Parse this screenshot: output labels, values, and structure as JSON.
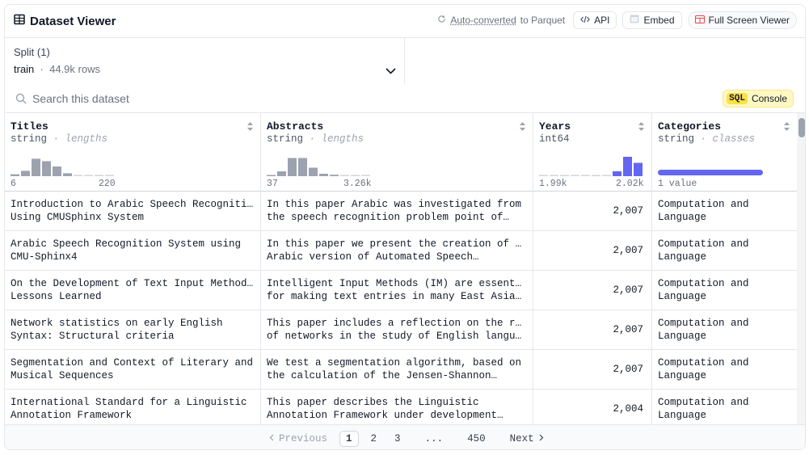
{
  "header": {
    "title": "Dataset Viewer",
    "auto_converted": "Auto-converted",
    "to_parquet": "to Parquet",
    "api": "API",
    "embed": "Embed",
    "full_screen": "Full Screen Viewer"
  },
  "split": {
    "label": "Split (1)",
    "value": "train",
    "rows": "44.9k rows"
  },
  "search": {
    "placeholder": "Search this dataset"
  },
  "sql": {
    "tag": "SQL",
    "label": "Console"
  },
  "colors": {
    "hist_gray": "#9ca3af",
    "hist_accent": "#6366f1",
    "border": "#e5e7eb"
  },
  "columns": [
    {
      "name": "Titles",
      "type": "string",
      "sub": "lengths",
      "min": "6",
      "max": "220",
      "hist": [
        0.08,
        0.22,
        0.72,
        0.62,
        0.4,
        0.12,
        0.04,
        0.03,
        0.03,
        0.02
      ]
    },
    {
      "name": "Abstracts",
      "type": "string",
      "sub": "lengths",
      "min": "37",
      "max": "3.26k",
      "hist": [
        0.05,
        0.2,
        0.75,
        0.75,
        0.35,
        0.1,
        0.06,
        0.03,
        0.02,
        0.02
      ]
    },
    {
      "name": "Years",
      "type": "int64",
      "sub": "",
      "min": "1.99k",
      "max": "2.02k",
      "hist": [
        0.02,
        0.02,
        0.02,
        0.02,
        0.02,
        0.03,
        0.03,
        0.2,
        0.8,
        0.55
      ]
    },
    {
      "name": "Categories",
      "type": "string",
      "sub": "classes",
      "min": "1 value",
      "max": "",
      "hist": [
        1.0
      ]
    }
  ],
  "rows": [
    {
      "title": [
        "Introduction to Arabic Speech Recognition",
        "Using CMUSphinx System"
      ],
      "abstract": [
        "In this paper Arabic was investigated from",
        "the speech recognition problem point of…"
      ],
      "year": "2,007",
      "category": [
        "Computation and",
        "Language"
      ]
    },
    {
      "title": [
        "Arabic Speech Recognition System using",
        "CMU-Sphinx4"
      ],
      "abstract": [
        "In this paper we present the creation of an",
        "Arabic version of Automated Speech…"
      ],
      "year": "2,007",
      "category": [
        "Computation and",
        "Language"
      ]
    },
    {
      "title": [
        "On the Development of Text Input Method -",
        "Lessons Learned"
      ],
      "abstract": [
        "Intelligent Input Methods (IM) are essential",
        "for making text entries in many East Asian…"
      ],
      "year": "2,007",
      "category": [
        "Computation and",
        "Language"
      ]
    },
    {
      "title": [
        "Network statistics on early English",
        "Syntax: Structural criteria"
      ],
      "abstract": [
        "This paper includes a reflection on the role",
        "of networks in the study of English languag…"
      ],
      "year": "2,007",
      "category": [
        "Computation and",
        "Language"
      ]
    },
    {
      "title": [
        "Segmentation and Context of Literary and",
        "Musical Sequences"
      ],
      "abstract": [
        "We test a segmentation algorithm, based on",
        "the calculation of the Jensen-Shannon…"
      ],
      "year": "2,007",
      "category": [
        "Computation and",
        "Language"
      ]
    },
    {
      "title": [
        "International Standard for a Linguistic",
        "Annotation Framework"
      ],
      "abstract": [
        "This paper describes the Linguistic",
        "Annotation Framework under development…"
      ],
      "year": "2,004",
      "category": [
        "Computation and",
        "Language"
      ]
    }
  ],
  "pager": {
    "previous": "Previous",
    "pages": [
      "1",
      "2",
      "3",
      "...",
      "450"
    ],
    "active": "1",
    "next": "Next"
  }
}
